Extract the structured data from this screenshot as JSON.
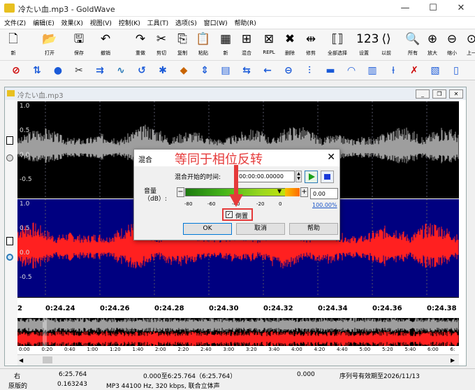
{
  "window": {
    "title": "冷たい血.mp3 - GoldWave",
    "min": "—",
    "max": "☐",
    "close": "✕"
  },
  "menu": [
    "文件(Z)",
    "编辑(E)",
    "效果(X)",
    "视图(V)",
    "控制(K)",
    "工具(T)",
    "选项(S)",
    "窗口(W)",
    "帮助(R)"
  ],
  "toolbar": [
    {
      "label": "新",
      "icon": "new-file-icon",
      "glyph": "🗋"
    },
    {
      "label": "打开",
      "icon": "open-folder-icon",
      "glyph": "📂"
    },
    {
      "label": "保存",
      "icon": "save-icon",
      "glyph": "🖫"
    },
    {
      "label": "撤销",
      "icon": "undo-icon",
      "glyph": "↶"
    },
    {
      "label": "重做",
      "icon": "redo-icon",
      "glyph": "↷"
    },
    {
      "label": "剪切",
      "icon": "cut-icon",
      "glyph": "✂"
    },
    {
      "label": "复制",
      "icon": "copy-icon",
      "glyph": "⎘"
    },
    {
      "label": "粘贴",
      "icon": "paste-icon",
      "glyph": "📋"
    },
    {
      "label": "新",
      "icon": "paste-new-icon",
      "glyph": "▦"
    },
    {
      "label": "混合",
      "icon": "mix-icon",
      "glyph": "⊞"
    },
    {
      "label": "REPL",
      "icon": "replace-icon",
      "glyph": "⊠"
    },
    {
      "label": "删除",
      "icon": "delete-icon",
      "glyph": "✖"
    },
    {
      "label": "修剪",
      "icon": "trim-icon",
      "glyph": "⇹"
    },
    {
      "label": "全部选择",
      "icon": "select-all-icon",
      "glyph": "⟦⟧"
    },
    {
      "label": "设置",
      "icon": "set-icon",
      "glyph": "123"
    },
    {
      "label": "以前",
      "icon": "previous-icon",
      "glyph": "⟨⟩"
    },
    {
      "label": "所有",
      "icon": "zoom-all-icon",
      "glyph": "🔍"
    },
    {
      "label": "放大",
      "icon": "zoom-in-icon",
      "glyph": "⊕"
    },
    {
      "label": "缩小",
      "icon": "zoom-out-icon",
      "glyph": "⊖"
    },
    {
      "label": "上一",
      "icon": "zoom-previous-icon",
      "glyph": "⊙"
    }
  ],
  "effects_toolbar": [
    "⊘",
    "⇅",
    "●",
    "✂",
    "⇉",
    "∿",
    "↺",
    "✱",
    "◆",
    "⇕",
    "▤",
    "⇆",
    "←",
    "⊖",
    "⫶",
    "▬",
    "◠",
    "▥",
    "⟊",
    "✗",
    "▧",
    "▯"
  ],
  "document": {
    "title": "冷たい血.mp3",
    "min": "_",
    "restore": "❐",
    "close": "✕"
  },
  "axis_top": [
    "1.0",
    "0.5",
    "0.0",
    "-0.5"
  ],
  "axis_bottom": [
    "1.0",
    "0.5",
    "0.0",
    "-0.5"
  ],
  "timeline": {
    "start": "2",
    "ticks": [
      "0:24.24",
      "0:24.26",
      "0:24.28",
      "0:24.30",
      "0:24.32",
      "0:24.34",
      "0:24.36",
      "0:24.38"
    ]
  },
  "overview_ticks": [
    "0:00",
    "0:20",
    "0:40",
    "1:00",
    "1:20",
    "1:40",
    "2:00",
    "2:20",
    "2:40",
    "3:00",
    "3:20",
    "3:40",
    "4:00",
    "4:20",
    "4:40",
    "5:00",
    "5:20",
    "5:40",
    "6:00",
    "6:"
  ],
  "dialog": {
    "title": "混合",
    "start_label": "混合开始的时间:",
    "start_value": "00:00:00.00000",
    "volume_label": "音量（dB）:",
    "volume_value": "0.00",
    "scale": [
      "-80",
      "-60",
      "-40",
      "-20",
      "0"
    ],
    "percent": "100.00%",
    "invert_label": "倒置",
    "invert_checked": true,
    "ok": "OK",
    "cancel": "取消",
    "help": "帮助"
  },
  "annotation": "等同于相位反转",
  "status": {
    "channel": "右",
    "duration": "6:25.764",
    "selection": "0.000至6:25.764（6:25.764）",
    "position": "0.000",
    "license": "序列号有效期至2026/11/13",
    "original_label": "原版的",
    "original_value": "0.163243",
    "format": "MP3 44100 Hz, 320 kbps, 联合立体声"
  },
  "colors": {
    "wave_top": "#9e9e9e",
    "wave_bottom": "#ff2020",
    "bg_top": "#000000",
    "bg_bottom": "#000080",
    "annotation": "#e53a3a"
  }
}
